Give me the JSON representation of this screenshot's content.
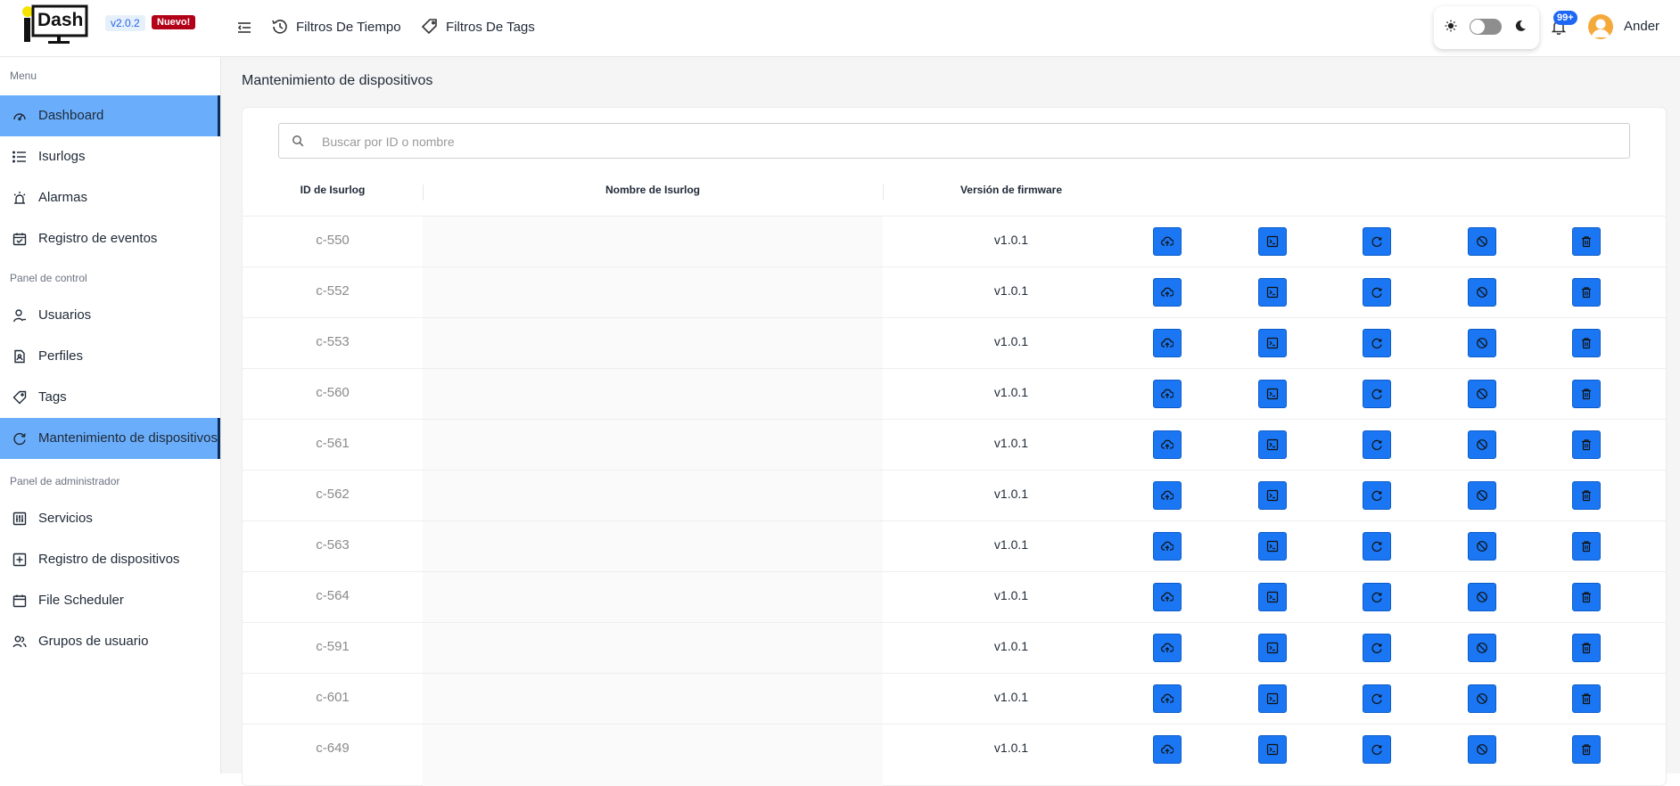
{
  "header": {
    "logo_text": "Dash",
    "version": "v2.0.2",
    "new_badge": "Nuevo!",
    "filters": [
      {
        "label": "Filtros De Tiempo",
        "icon": "clock-icon"
      },
      {
        "label": "Filtros De Tags",
        "icon": "tag-icon"
      }
    ],
    "notifications_count": "99+",
    "user_name": "Ander"
  },
  "sidebar": {
    "sections": [
      {
        "label": "Menu",
        "items": [
          {
            "label": "Dashboard",
            "icon": "dashboard-icon",
            "active": true
          },
          {
            "label": "Isurlogs",
            "icon": "list-icon",
            "active": false
          },
          {
            "label": "Alarmas",
            "icon": "alarm-icon",
            "active": false
          },
          {
            "label": "Registro de eventos",
            "icon": "calendar-check-icon",
            "active": false
          }
        ]
      },
      {
        "label": "Panel de control",
        "items": [
          {
            "label": "Usuarios",
            "icon": "user-icon",
            "active": false
          },
          {
            "label": "Perfiles",
            "icon": "profile-doc-icon",
            "active": false
          },
          {
            "label": "Tags",
            "icon": "tag-icon",
            "active": false
          },
          {
            "label": "Mantenimiento de dispositivos",
            "icon": "refresh-icon",
            "active": true
          }
        ]
      },
      {
        "label": "Panel de administrador",
        "items": [
          {
            "label": "Servicios",
            "icon": "sliders-icon",
            "active": false
          },
          {
            "label": "Registro de dispositivos",
            "icon": "plus-square-icon",
            "active": false
          },
          {
            "label": "File Scheduler",
            "icon": "calendar-icon",
            "active": false
          },
          {
            "label": "Grupos de usuario",
            "icon": "user-group-icon",
            "active": false
          }
        ]
      }
    ]
  },
  "main": {
    "title": "Mantenimiento de dispositivos",
    "search_placeholder": "Buscar por ID o nombre",
    "columns": [
      "ID de Isurlog",
      "Nombre de Isurlog",
      "Versión de firmware"
    ],
    "actions": [
      "upload-firmware-icon",
      "terminal-icon",
      "refresh-icon",
      "block-icon",
      "trash-icon"
    ],
    "rows": [
      {
        "id": "c-550",
        "name": "",
        "firmware": "v1.0.1"
      },
      {
        "id": "c-552",
        "name": "",
        "firmware": "v1.0.1"
      },
      {
        "id": "c-553",
        "name": "",
        "firmware": "v1.0.1"
      },
      {
        "id": "c-560",
        "name": "",
        "firmware": "v1.0.1"
      },
      {
        "id": "c-561",
        "name": "",
        "firmware": "v1.0.1"
      },
      {
        "id": "c-562",
        "name": "",
        "firmware": "v1.0.1"
      },
      {
        "id": "c-563",
        "name": "",
        "firmware": "v1.0.1"
      },
      {
        "id": "c-564",
        "name": "",
        "firmware": "v1.0.1"
      },
      {
        "id": "c-591",
        "name": "",
        "firmware": "v1.0.1"
      },
      {
        "id": "c-601",
        "name": "",
        "firmware": "v1.0.1"
      },
      {
        "id": "c-649",
        "name": "",
        "firmware": "v1.0.1"
      }
    ]
  },
  "colors": {
    "accent": "#1a76f2",
    "sidebar_active": "#6aaefb",
    "new_badge": "#b30019",
    "avatar": "#f6a93b"
  }
}
